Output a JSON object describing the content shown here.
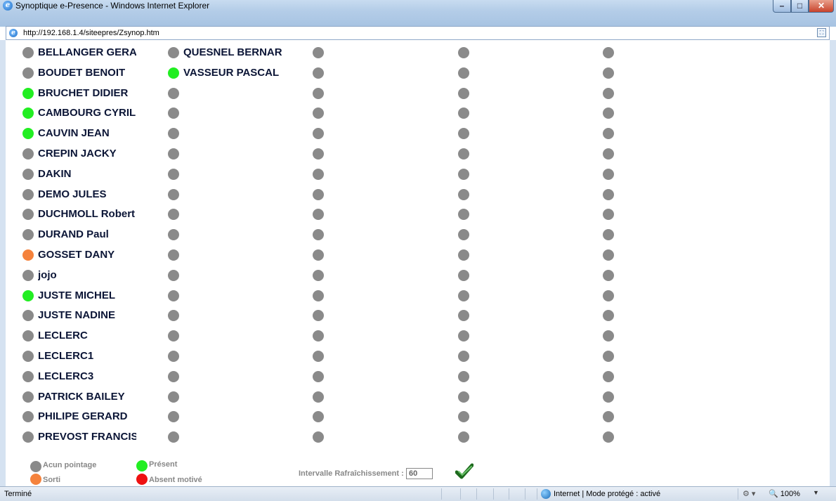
{
  "window": {
    "title": "Synoptique e-Presence - Windows Internet Explorer",
    "minimize": "–",
    "maximize": "□",
    "close": "✕"
  },
  "address": {
    "url": "http://192.168.1.4/siteepres/Zsynop.htm"
  },
  "colors": {
    "none": "#8a8a8a",
    "present": "#22ee22",
    "out": "#f5823c",
    "absent": "#ee1111"
  },
  "people": [
    {
      "name": "BELLANGER GERA",
      "status": "none"
    },
    {
      "name": "BOUDET BENOIT",
      "status": "none"
    },
    {
      "name": "BRUCHET DIDIER",
      "status": "present"
    },
    {
      "name": "CAMBOURG CYRIL",
      "status": "present"
    },
    {
      "name": "CAUVIN JEAN",
      "status": "present"
    },
    {
      "name": "CREPIN JACKY",
      "status": "none"
    },
    {
      "name": "DAKIN",
      "status": "none"
    },
    {
      "name": "DEMO JULES",
      "status": "none"
    },
    {
      "name": "DUCHMOLL Robert",
      "status": "none"
    },
    {
      "name": "DURAND Paul",
      "status": "none"
    },
    {
      "name": "GOSSET DANY",
      "status": "out"
    },
    {
      "name": "jojo",
      "status": "none"
    },
    {
      "name": "JUSTE MICHEL",
      "status": "present"
    },
    {
      "name": "JUSTE NADINE",
      "status": "none"
    },
    {
      "name": "LECLERC",
      "status": "none"
    },
    {
      "name": "LECLERC1",
      "status": "none"
    },
    {
      "name": "LECLERC3",
      "status": "none"
    },
    {
      "name": "PATRICK BAILEY",
      "status": "none"
    },
    {
      "name": "PHILIPE GERARD",
      "status": "none"
    },
    {
      "name": "PREVOST FRANCIS",
      "status": "none"
    },
    {
      "name": "QUESNEL BERNAR",
      "status": "none"
    },
    {
      "name": "VASSEUR PASCAL",
      "status": "present"
    }
  ],
  "slots_per_column": 20,
  "column_count": 5,
  "legend": {
    "none": "Acun pointage",
    "present": "Présent",
    "out": "Sorti",
    "absent": "Absent motivé"
  },
  "refresh": {
    "label": "Intervalle Rafraîchissement :",
    "value": "60"
  },
  "statusbar": {
    "left": "Terminé",
    "zone": "Internet | Mode protégé : activé",
    "zoom": "100%"
  }
}
